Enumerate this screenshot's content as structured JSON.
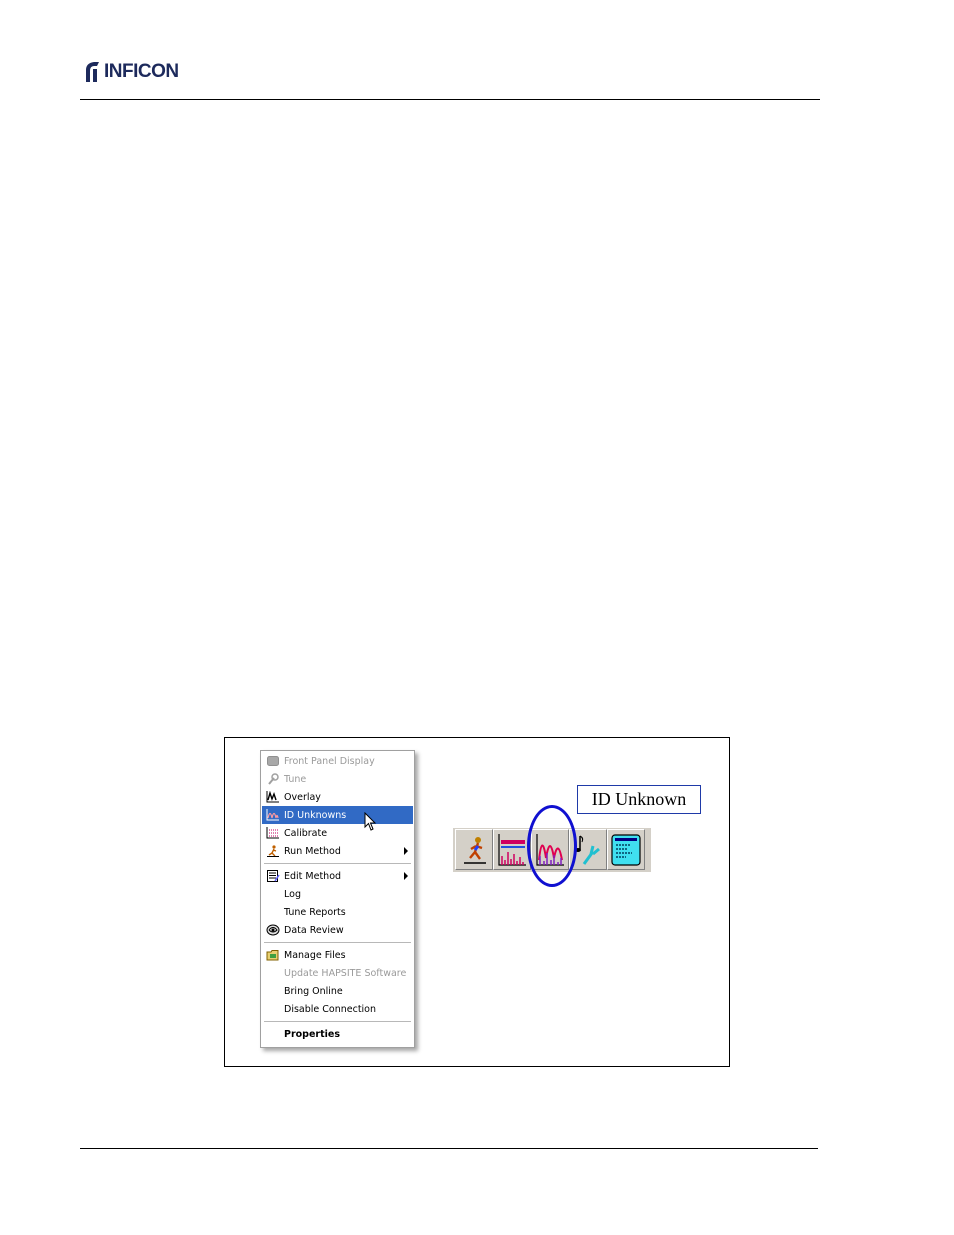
{
  "header": {
    "logo_text": "INFICON"
  },
  "figure": {
    "context_menu": {
      "items": [
        {
          "label": "Front Panel Display",
          "enabled": false,
          "icon": "front-panel-icon"
        },
        {
          "label": "Tune",
          "enabled": false,
          "icon": "tune-icon"
        },
        {
          "label": "Overlay",
          "enabled": true,
          "icon": "overlay-icon"
        },
        {
          "label": "ID Unknowns",
          "enabled": true,
          "highlighted": true,
          "icon": "id-unknowns-icon"
        },
        {
          "label": "Calibrate",
          "enabled": true,
          "icon": "calibrate-icon"
        },
        {
          "label": "Run Method",
          "enabled": true,
          "submenu": true,
          "icon": "run-method-icon"
        },
        {
          "label": "Edit Method",
          "enabled": true,
          "submenu": true,
          "icon": "edit-method-icon"
        },
        {
          "label": "Log",
          "enabled": true
        },
        {
          "label": "Tune Reports",
          "enabled": true
        },
        {
          "label": "Data Review",
          "enabled": true,
          "icon": "data-review-icon"
        },
        {
          "label": "Manage Files",
          "enabled": true,
          "icon": "manage-files-icon"
        },
        {
          "label": "Update HAPSITE Software",
          "enabled": false
        },
        {
          "label": "Bring Online",
          "enabled": true
        },
        {
          "label": "Disable Connection",
          "enabled": true
        },
        {
          "label": "Properties",
          "enabled": true,
          "bold": true
        }
      ]
    },
    "tooltip_label": "ID Unknown",
    "toolbar": {
      "buttons": [
        "run-method-icon",
        "overlay-icon",
        "id-unknowns-icon",
        "tune-icon",
        "front-panel-display-icon"
      ]
    },
    "colors": {
      "highlight": "#316ac5",
      "circle": "#1010d0",
      "toolbar_bg": "#d4d0c8"
    }
  }
}
